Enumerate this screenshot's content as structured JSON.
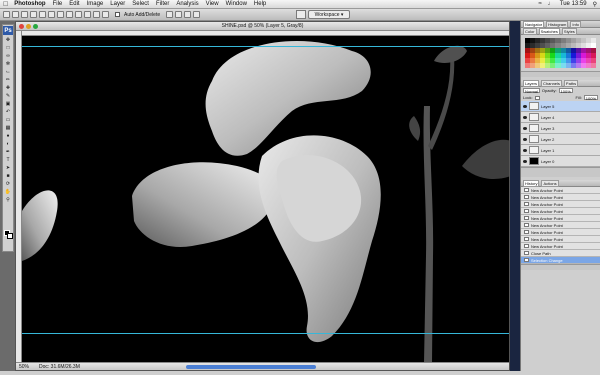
{
  "menubar": {
    "app": "Photoshop",
    "items": [
      "File",
      "Edit",
      "Image",
      "Layer",
      "Select",
      "Filter",
      "Analysis",
      "View",
      "Window",
      "Help"
    ],
    "clock": "Tue 13:59"
  },
  "options": {
    "auto_select_label": "Auto Add/Delete",
    "workspace_label": "Workspace"
  },
  "document": {
    "title": "SHINE.psd @ 50% (Layer 5, Gray/8)",
    "zoom": "50%",
    "doc_size": "Doc: 31.6M/26.3M",
    "guides": [
      0.03,
      0.91
    ],
    "scroll_position": 0.35
  },
  "panels": {
    "top_tabs": [
      "Navigator",
      "Histogram",
      "Info"
    ],
    "color_tabs": [
      "Color",
      "Swatches",
      "Styles"
    ],
    "layer_tabs": [
      "Layers",
      "Channels",
      "Paths"
    ],
    "blend_mode": "Normal",
    "opacity_label": "Opacity:",
    "opacity": "100%",
    "fill_label": "Fill:",
    "fill": "100%",
    "lock_label": "Lock:",
    "layers": [
      {
        "name": "Layer 5",
        "selected": true,
        "dark": false
      },
      {
        "name": "Layer 4",
        "selected": false,
        "dark": false
      },
      {
        "name": "Layer 3",
        "selected": false,
        "dark": false
      },
      {
        "name": "Layer 2",
        "selected": false,
        "dark": false
      },
      {
        "name": "Layer 1",
        "selected": false,
        "dark": false
      },
      {
        "name": "Layer 0",
        "selected": false,
        "dark": true
      }
    ],
    "history_tabs": [
      "History",
      "Actions"
    ],
    "history": [
      {
        "name": "New Anchor Point",
        "selected": false
      },
      {
        "name": "New Anchor Point",
        "selected": false
      },
      {
        "name": "New Anchor Point",
        "selected": false
      },
      {
        "name": "New Anchor Point",
        "selected": false
      },
      {
        "name": "New Anchor Point",
        "selected": false
      },
      {
        "name": "New Anchor Point",
        "selected": false
      },
      {
        "name": "New Anchor Point",
        "selected": false
      },
      {
        "name": "New Anchor Point",
        "selected": false
      },
      {
        "name": "New Anchor Point",
        "selected": false
      },
      {
        "name": "Close Path",
        "selected": false
      },
      {
        "name": "Selection Change",
        "selected": true
      }
    ]
  },
  "colors": {
    "accent": "#3b6fd1",
    "guide": "#36b7d9",
    "canvas": "#000000"
  }
}
